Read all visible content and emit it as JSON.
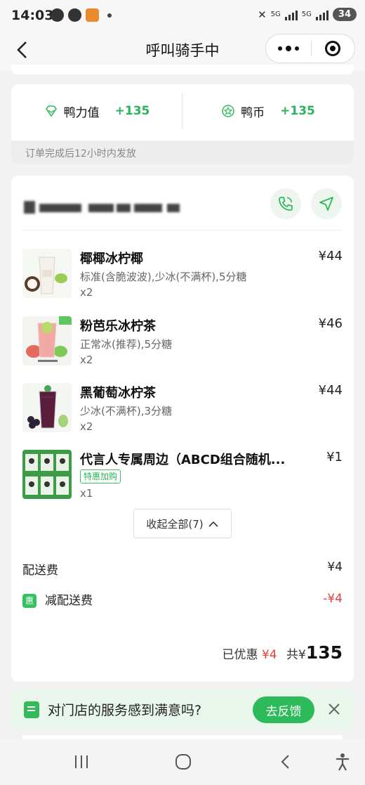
{
  "status_bar": {
    "time": "14:03",
    "network_1": "5G",
    "network_2": "5G",
    "battery": "34"
  },
  "nav": {
    "title": "呼叫骑手中"
  },
  "rewards": {
    "items": [
      {
        "label": "鸭力值",
        "value": "+135",
        "icon": "diamond-icon"
      },
      {
        "label": "鸭币",
        "value": "+135",
        "icon": "star-coin-icon"
      }
    ],
    "note": "订单完成后12小时内发放"
  },
  "order": {
    "items": [
      {
        "name": "椰椰冰柠椰",
        "spec": "标准(含脆波波),少冰(不满杯),5分糖",
        "qty": "x2",
        "price": "¥44",
        "tag": ""
      },
      {
        "name": "粉芭乐冰柠茶",
        "spec": "正常冰(推荐),5分糖",
        "qty": "x2",
        "price": "¥46",
        "tag": ""
      },
      {
        "name": "黑葡萄冰柠茶",
        "spec": "少冰(不满杯),3分糖",
        "qty": "x2",
        "price": "¥44",
        "tag": ""
      },
      {
        "name": "代言人专属周边（ABCD组合随机...",
        "spec": "",
        "qty": "x1",
        "price": "¥1",
        "tag": "特惠加购"
      }
    ],
    "collapse_label": "收起全部(7)",
    "delivery_fee_label": "配送费",
    "delivery_fee_value": "¥4",
    "discount_badge": "惠",
    "discount_label": "减配送费",
    "discount_value": "-¥4",
    "saved_label": "已优惠",
    "saved_value": "¥4",
    "total_label": "共¥",
    "total_value": "135"
  },
  "feedback": {
    "question": "对门店的服务感到满意吗?",
    "button": "去反馈"
  },
  "colors": {
    "accent": "#2dba5a",
    "discount": "#e04040"
  }
}
